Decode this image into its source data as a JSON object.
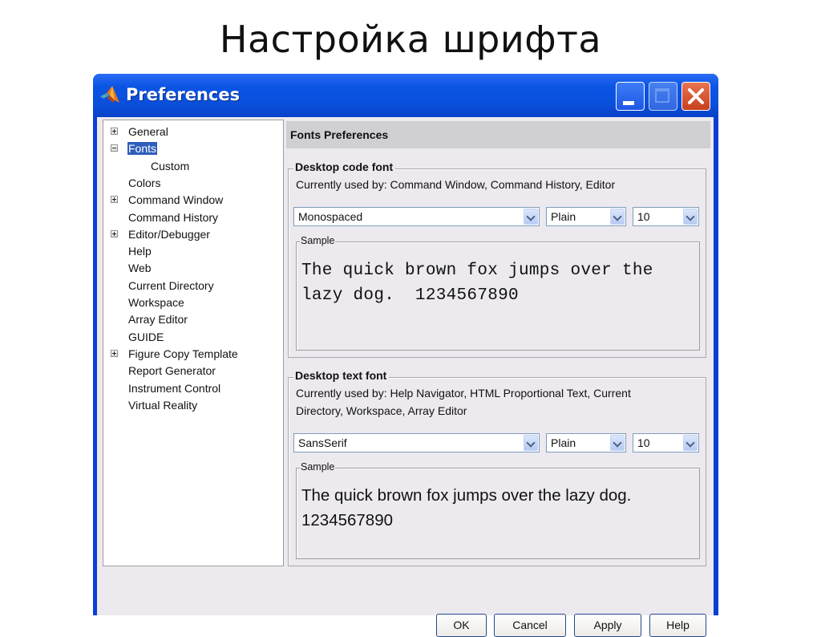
{
  "slide": {
    "title": "Настройка шрифта"
  },
  "window": {
    "title": "Preferences",
    "icon": "matlab-logo-icon",
    "controls": {
      "minimize": "minimize-icon",
      "maximize": "maximize-icon",
      "close": "close-icon"
    }
  },
  "tree": {
    "items": [
      {
        "label": "General",
        "expander": "plus",
        "level": 0,
        "selected": false
      },
      {
        "label": "Fonts",
        "expander": "minus",
        "level": 0,
        "selected": true
      },
      {
        "label": "Custom",
        "expander": null,
        "level": 1,
        "selected": false
      },
      {
        "label": "Colors",
        "expander": null,
        "level": 0,
        "selected": false
      },
      {
        "label": "Command Window",
        "expander": "plus",
        "level": 0,
        "selected": false
      },
      {
        "label": "Command History",
        "expander": null,
        "level": 0,
        "selected": false
      },
      {
        "label": "Editor/Debugger",
        "expander": "plus",
        "level": 0,
        "selected": false
      },
      {
        "label": "Help",
        "expander": null,
        "level": 0,
        "selected": false
      },
      {
        "label": "Web",
        "expander": null,
        "level": 0,
        "selected": false
      },
      {
        "label": "Current Directory",
        "expander": null,
        "level": 0,
        "selected": false
      },
      {
        "label": "Workspace",
        "expander": null,
        "level": 0,
        "selected": false
      },
      {
        "label": "Array Editor",
        "expander": null,
        "level": 0,
        "selected": false
      },
      {
        "label": "GUIDE",
        "expander": null,
        "level": 0,
        "selected": false
      },
      {
        "label": "Figure Copy Template",
        "expander": "plus",
        "level": 0,
        "selected": false
      },
      {
        "label": "Report Generator",
        "expander": null,
        "level": 0,
        "selected": false
      },
      {
        "label": "Instrument Control",
        "expander": null,
        "level": 0,
        "selected": false
      },
      {
        "label": "Virtual Reality",
        "expander": null,
        "level": 0,
        "selected": false
      }
    ]
  },
  "panel": {
    "header": "Fonts Preferences",
    "code_font": {
      "title": "Desktop code font",
      "used_by": "Currently used by: Command Window, Command History, Editor",
      "family": "Monospaced",
      "style": "Plain",
      "size": "10",
      "sample_title": "Sample",
      "sample_line1": "The quick brown fox jumps over the",
      "sample_line2": "lazy dog.  1234567890"
    },
    "text_font": {
      "title": "Desktop text font",
      "used_by_line1": "Currently used by: Help Navigator, HTML Proportional Text, Current",
      "used_by_line2": "Directory, Workspace, Array Editor",
      "family": "SansSerif",
      "style": "Plain",
      "size": "10",
      "sample_title": "Sample",
      "sample_line1": "The quick brown fox jumps over the lazy dog.",
      "sample_line2": "1234567890"
    }
  },
  "buttons": {
    "ok": "OK",
    "cancel": "Cancel",
    "apply": "Apply",
    "help": "Help"
  }
}
